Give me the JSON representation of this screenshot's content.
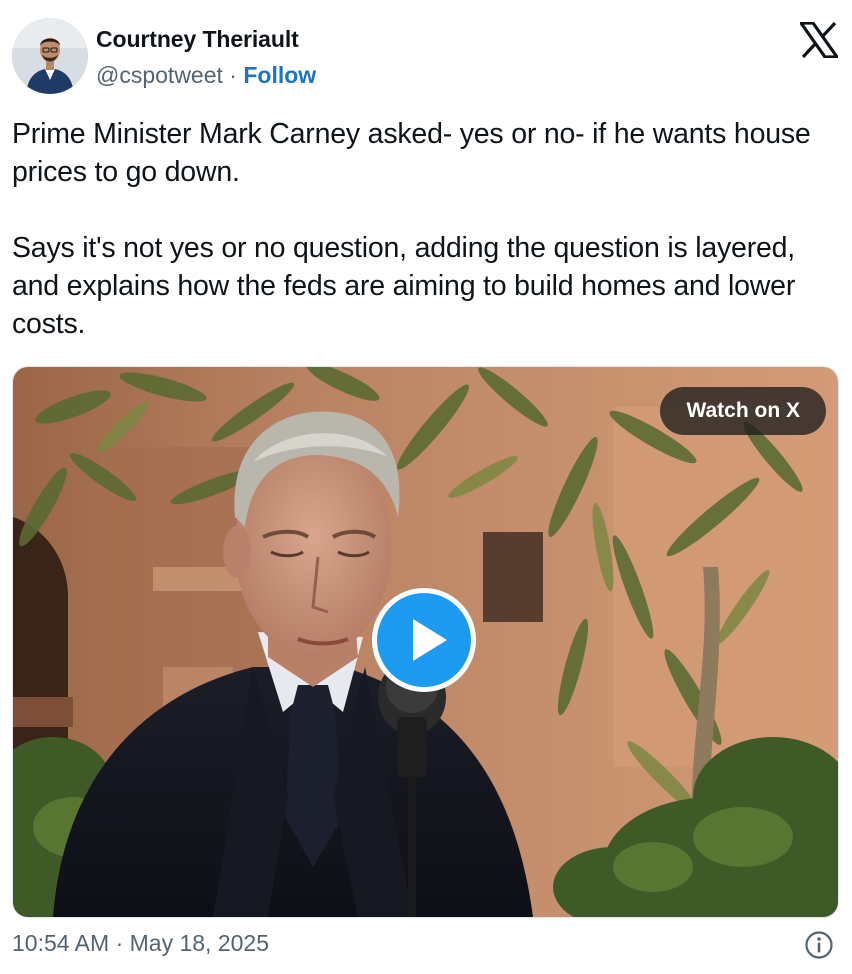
{
  "author": {
    "name": "Courtney Theriault",
    "handle": "@cspotweet",
    "separator": " · ",
    "follow_label": "Follow"
  },
  "tweet": {
    "paragraphs": [
      "Prime Minister Mark Carney asked- yes or no- if he wants house prices to go down.",
      "Says it's not yes or no question, adding the question is layered, and explains how the feds are aiming to build homes and lower costs."
    ]
  },
  "media": {
    "watch_label": "Watch on X",
    "play_icon": "play-icon"
  },
  "footer": {
    "timestamp": "10:54 AM · May 18, 2025",
    "info_icon": "info-icon"
  },
  "icons": {
    "brand": "x-logo-icon"
  },
  "colors": {
    "follow": "#1d74c7",
    "play_button": "#1d9bf0",
    "secondary_text": "#536471",
    "primary_text": "#0f1419"
  }
}
